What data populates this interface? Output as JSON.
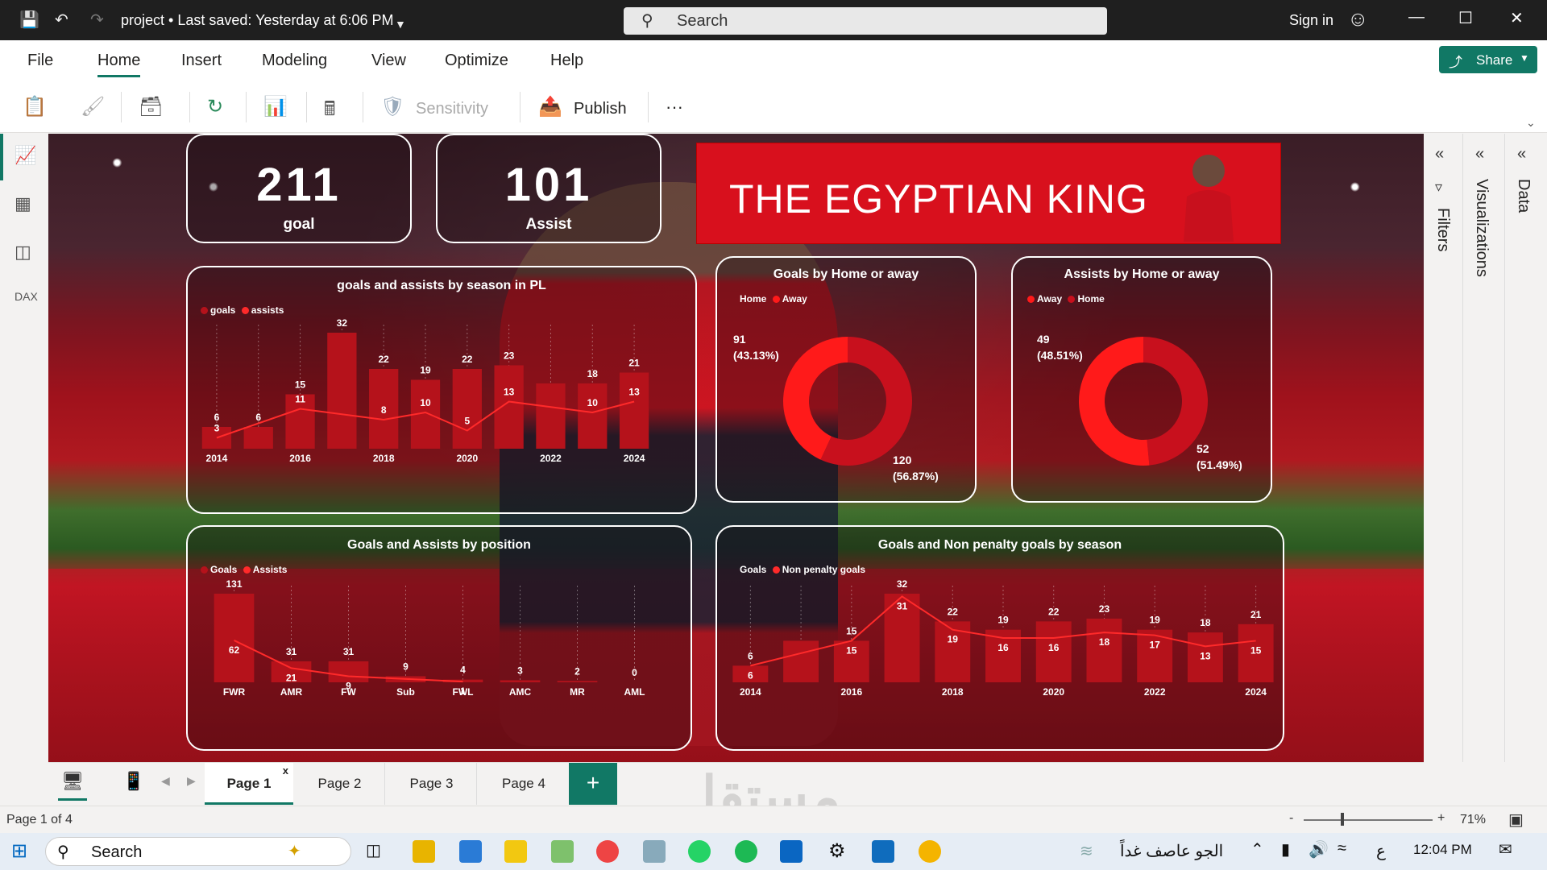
{
  "titlebar": {
    "doc_title": "project  •  Last saved: Yesterday at 6:06 PM",
    "search_placeholder": "Search",
    "signin": "Sign in"
  },
  "menu": {
    "items": [
      "File",
      "Home",
      "Insert",
      "Modeling",
      "View",
      "Optimize",
      "Help"
    ],
    "active": "Home",
    "share": "Share"
  },
  "ribbon": {
    "sensitivity": "Sensitivity",
    "publish": "Publish",
    "more": "···"
  },
  "panes": {
    "filters": "Filters",
    "visualizations": "Visualizations",
    "data": "Data"
  },
  "kpis": [
    {
      "value": "211",
      "label": "goal"
    },
    {
      "value": "101",
      "label": "Assist"
    }
  ],
  "banner": {
    "title": "THE EGYPTIAN KING"
  },
  "charts": {
    "season": {
      "title": "goals and assists by season in PL",
      "legend": [
        "goals",
        "assists"
      ]
    },
    "home_goals": {
      "title": "Goals by Home or away",
      "legend": [
        "Home",
        "Away"
      ]
    },
    "home_assists": {
      "title": "Assists by Home or away",
      "legend": [
        "Away",
        "Home"
      ]
    },
    "position": {
      "title": "Goals and Assists by position",
      "legend": [
        "Goals",
        "Assists"
      ]
    },
    "penalty": {
      "title": "Goals and Non penalty goals by season",
      "legend": [
        "Goals",
        "Non penalty goals"
      ]
    }
  },
  "chart_data": [
    {
      "type": "bar",
      "title": "goals and assists by season in PL",
      "categories": [
        "2014",
        "2015",
        "2016",
        "2017",
        "2018",
        "2019",
        "2020",
        "2021",
        "2022",
        "2023",
        "2024"
      ],
      "x_tick_labels": [
        "2014",
        "2016",
        "2018",
        "2020",
        "2022",
        "2024"
      ],
      "series": [
        {
          "name": "goals",
          "values": [
            6,
            6,
            15,
            32,
            22,
            19,
            22,
            23,
            null,
            18,
            21
          ]
        },
        {
          "name": "assists",
          "values": [
            3,
            null,
            11,
            null,
            8,
            10,
            5,
            13,
            null,
            10,
            13
          ]
        }
      ],
      "colors": {
        "goals": "#b5121b",
        "assists": "#ff2a2a"
      }
    },
    {
      "type": "pie",
      "title": "Goals by Home or away",
      "labels": [
        "Home",
        "Away"
      ],
      "values": [
        120,
        91
      ],
      "percents": [
        "(56.87%)",
        "(43.13%)"
      ],
      "colors": [
        "#c8101d",
        "#ff1a1a"
      ]
    },
    {
      "type": "pie",
      "title": "Assists by Home or away",
      "labels": [
        "Away",
        "Home"
      ],
      "values": [
        49,
        52
      ],
      "percents": [
        "(48.51%)",
        "(51.49%)"
      ],
      "colors": [
        "#c8101d",
        "#ff1a1a"
      ]
    },
    {
      "type": "bar",
      "title": "Goals and Assists by position",
      "categories": [
        "FWR",
        "AMR",
        "FW",
        "Sub",
        "FWL",
        "AMC",
        "MR",
        "AML"
      ],
      "series": [
        {
          "name": "Goals",
          "values": [
            131,
            31,
            31,
            9,
            4,
            3,
            2,
            0
          ]
        },
        {
          "name": "Assists",
          "values": [
            62,
            21,
            9,
            null,
            1,
            null,
            null,
            null
          ]
        }
      ],
      "colors": {
        "Goals": "#b5121b",
        "Assists": "#ff2a2a"
      }
    },
    {
      "type": "bar",
      "title": "Goals and Non penalty goals by season",
      "categories": [
        "2014",
        "2015",
        "2016",
        "2017",
        "2018",
        "2019",
        "2020",
        "2021",
        "2022",
        "2023",
        "2024"
      ],
      "x_tick_labels": [
        "2014",
        "2016",
        "2018",
        "2020",
        "2022",
        "2024"
      ],
      "series": [
        {
          "name": "Goals",
          "values": [
            6,
            null,
            15,
            32,
            22,
            19,
            22,
            23,
            19,
            18,
            21
          ]
        },
        {
          "name": "Non penalty goals",
          "values": [
            6,
            null,
            15,
            31,
            19,
            16,
            16,
            18,
            17,
            13,
            15
          ]
        }
      ],
      "colors": {
        "Goals": "#b5121b",
        "Non penalty goals": "#ff2a2a"
      }
    }
  ],
  "pages": {
    "tabs": [
      "Page 1",
      "Page 2",
      "Page 3",
      "Page 4"
    ],
    "active": "Page 1",
    "add": "+"
  },
  "status": {
    "page_info": "Page 1 of 4",
    "zoom": "71%"
  },
  "taskbar": {
    "search": "Search",
    "weather": "الجو عاصف غداً",
    "lang": "ع",
    "time": "12:04 PM"
  },
  "watermark": "مستقل"
}
